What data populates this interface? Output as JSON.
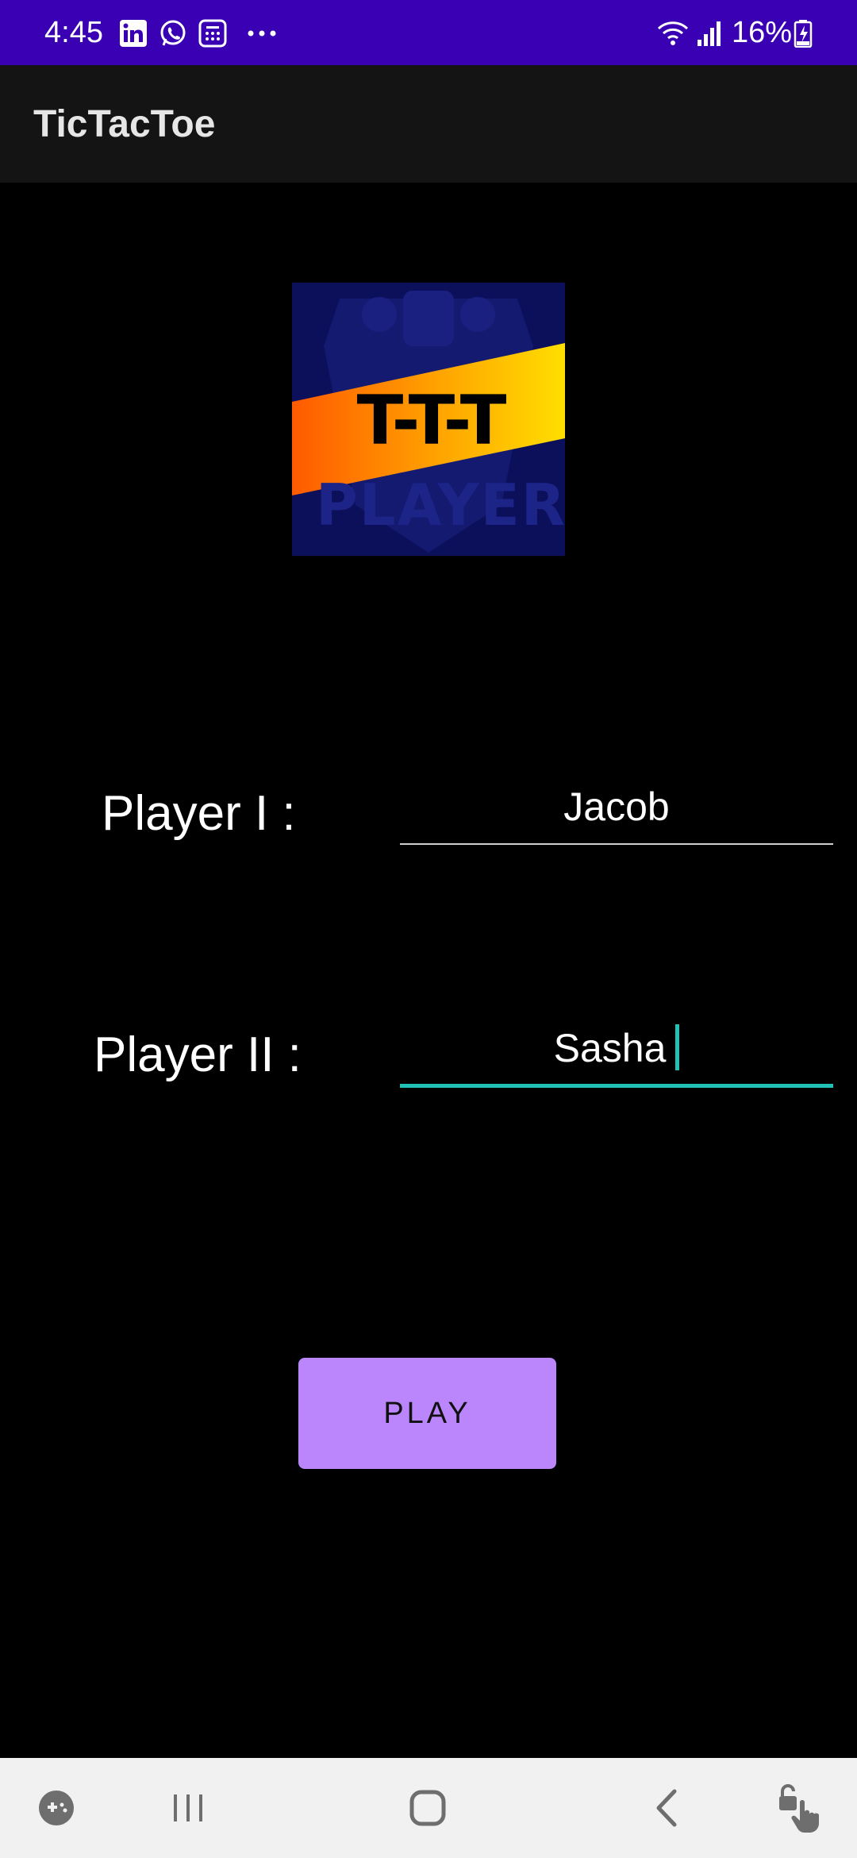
{
  "status_bar": {
    "time": "4:45",
    "battery_percent": "16%",
    "left_icons": [
      "linkedin-icon",
      "whatsapp-icon",
      "calculator-icon",
      "more-dots-icon"
    ],
    "right_icons": [
      "wifi-icon",
      "signal-icon",
      "battery-charging-icon"
    ],
    "background_color": "#3a00b3"
  },
  "app_bar": {
    "title": "TicTacToe"
  },
  "logo": {
    "banner_text": "T-T-T",
    "background_text": "PLAYER"
  },
  "form": {
    "player1": {
      "label": "Player I :",
      "value": "Jacob"
    },
    "player2": {
      "label": "Player II :",
      "value": "Sasha",
      "focused": true
    }
  },
  "play_button": {
    "label": "PLAY",
    "color": "#bb86fc"
  },
  "nav_bar": {
    "items": [
      "game-launcher-icon",
      "recent-apps-icon",
      "home-icon",
      "back-icon",
      "unlock-touch-icon"
    ]
  },
  "accent_color": "#22c1b5"
}
